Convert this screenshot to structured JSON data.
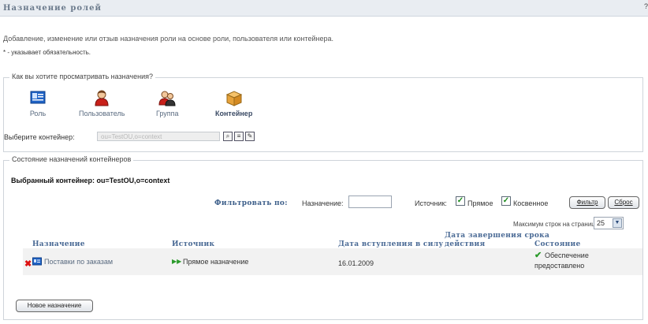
{
  "header": {
    "title": "Назначение ролей"
  },
  "description": "Добавление, изменение или отзыв назначения роли на основе роли, пользователя или контейнера.",
  "required_note": "* - указывает обязательность.",
  "view_section": {
    "legend": "Как вы хотите просматривать назначения?",
    "options": [
      {
        "label": "Роль",
        "icon": "role-icon"
      },
      {
        "label": "Пользователь",
        "icon": "user-icon"
      },
      {
        "label": "Группа",
        "icon": "group-icon"
      },
      {
        "label": "Контейнер",
        "icon": "container-icon",
        "selected": true
      }
    ],
    "container_label": "Выберите контейнер:",
    "container_value": "ou=TestOU,o=context"
  },
  "status_section": {
    "legend": "Состояние назначений контейнеров",
    "selected_container": "Выбранный контейнер: ou=TestOU,o=context",
    "filter": {
      "title": "Фильтровать по:",
      "assignment_label": "Назначение:",
      "assignment_value": "",
      "source_label": "Источник:",
      "direct_label": "Прямое",
      "direct_checked": true,
      "indirect_label": "Косвенное",
      "indirect_checked": true,
      "filter_button": "Фильтр",
      "reset_button": "Сброс"
    },
    "max_rows_label": "Максимум строк на странице:",
    "max_rows_value": "25",
    "columns": {
      "assignment": "Назначение",
      "source": "Источник",
      "effective_date": "Дата вступления в силу",
      "end_date_line1": "Дата завершения срока",
      "end_date_line2": "действия",
      "status": "Состояние"
    },
    "rows": [
      {
        "assignment": "Поставки по заказам",
        "source": "Прямое назначение",
        "effective_date": "16.01.2009",
        "end_date": "",
        "status_line1": "Обеспечение",
        "status_line2": "предоставлено"
      }
    ],
    "new_assignment_button": "Новое назначение"
  }
}
